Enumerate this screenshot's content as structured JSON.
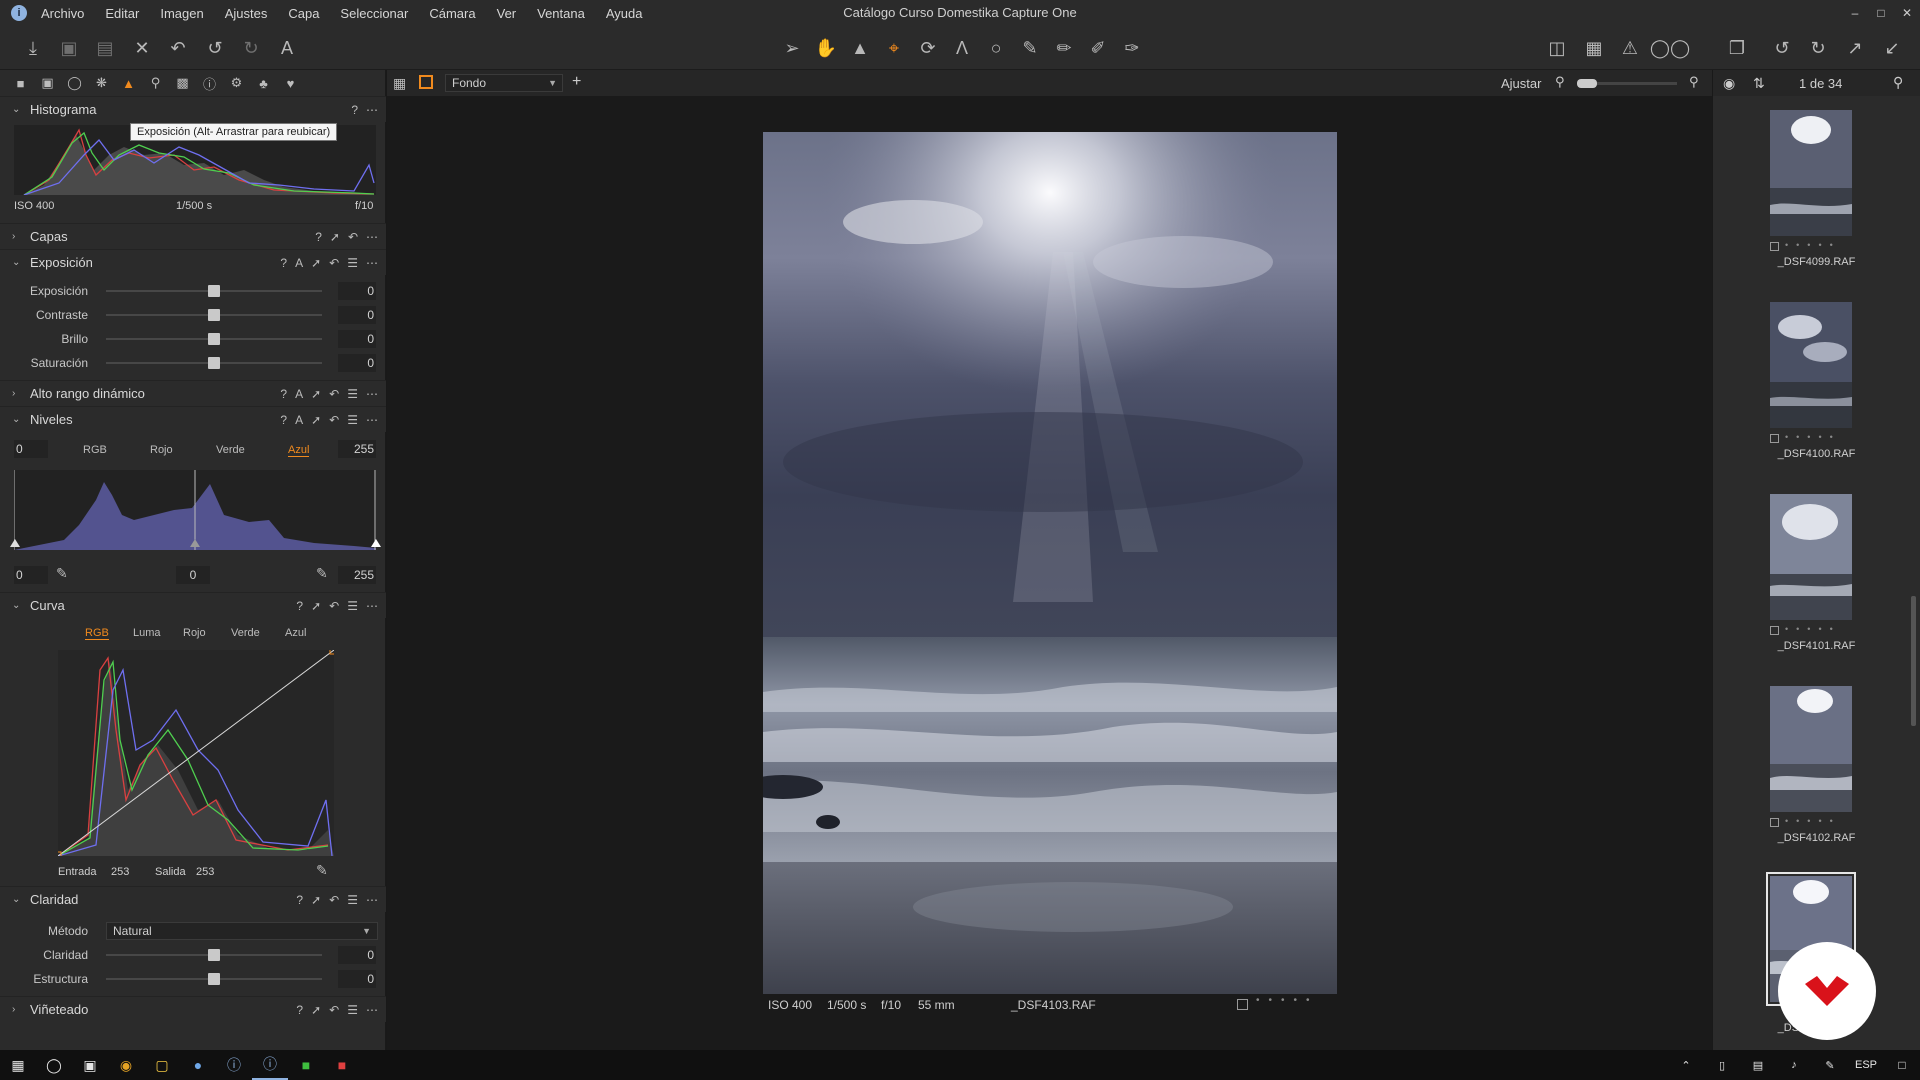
{
  "menubar": {
    "app_icon": "i",
    "items": [
      "Archivo",
      "Editar",
      "Imagen",
      "Ajustes",
      "Capa",
      "Seleccionar",
      "Cámara",
      "Ver",
      "Ventana",
      "Ayuda"
    ],
    "window_title": "Catálogo Curso Domestika Capture One"
  },
  "tooltip": "Exposición (Alt- Arrastrar para reubicar)",
  "histogram": {
    "title": "Histograma",
    "iso": "ISO 400",
    "shutter": "1/500 s",
    "aperture": "f/10"
  },
  "sections": {
    "capas": "Capas",
    "exposicion": "Exposición",
    "hdr": "Alto rango dinámico",
    "niveles": "Niveles",
    "curva": "Curva",
    "claridad": "Claridad",
    "vineteado": "Viñeteado"
  },
  "exposure": {
    "rows": [
      {
        "label": "Exposición",
        "value": "0",
        "level": 0.5
      },
      {
        "label": "Contraste",
        "value": "0",
        "level": 0.5
      },
      {
        "label": "Brillo",
        "value": "0",
        "level": 0.5
      },
      {
        "label": "Saturación",
        "value": "0",
        "level": 0.5
      }
    ]
  },
  "levels": {
    "tabs": [
      "RGB",
      "Rojo",
      "Verde",
      "Azul"
    ],
    "active_tab": "Azul",
    "input_min": "0",
    "input_max": "255",
    "output_min": "0",
    "midpoint": "0",
    "output_max": "255"
  },
  "curve": {
    "tabs": [
      "RGB",
      "Luma",
      "Rojo",
      "Verde",
      "Azul"
    ],
    "active_tab": "RGB",
    "input_label": "Entrada",
    "input_value": "253",
    "output_label": "Salida",
    "output_value": "253"
  },
  "clarity": {
    "method_label": "Método",
    "method_value": "Natural",
    "rows": [
      {
        "label": "Claridad",
        "value": "0",
        "level": 0.5
      },
      {
        "label": "Estructura",
        "value": "0",
        "level": 0.5
      }
    ]
  },
  "viewer": {
    "variant": "Fondo",
    "fit_label": "Ajustar",
    "counter": "1 de 34",
    "caption": {
      "iso": "ISO 400",
      "shutter": "1/500 s",
      "aperture": "f/10",
      "focal": "55 mm",
      "filename": "_DSF4103.RAF"
    }
  },
  "browser": {
    "thumbnails": [
      {
        "name": "_DSF4099.RAF",
        "selected": false
      },
      {
        "name": "_DSF4100.RAF",
        "selected": false
      },
      {
        "name": "_DSF4101.RAF",
        "selected": false
      },
      {
        "name": "_DSF4102.RAF",
        "selected": false
      },
      {
        "name": "_DSF4103.RAF",
        "selected": true
      }
    ]
  },
  "taskbar": {
    "language": "ESP"
  },
  "colors": {
    "accent": "#f08a1e",
    "panel": "#2b2b2b",
    "viewer_bg": "#1a1a1a",
    "watermark": "#d9121a"
  }
}
